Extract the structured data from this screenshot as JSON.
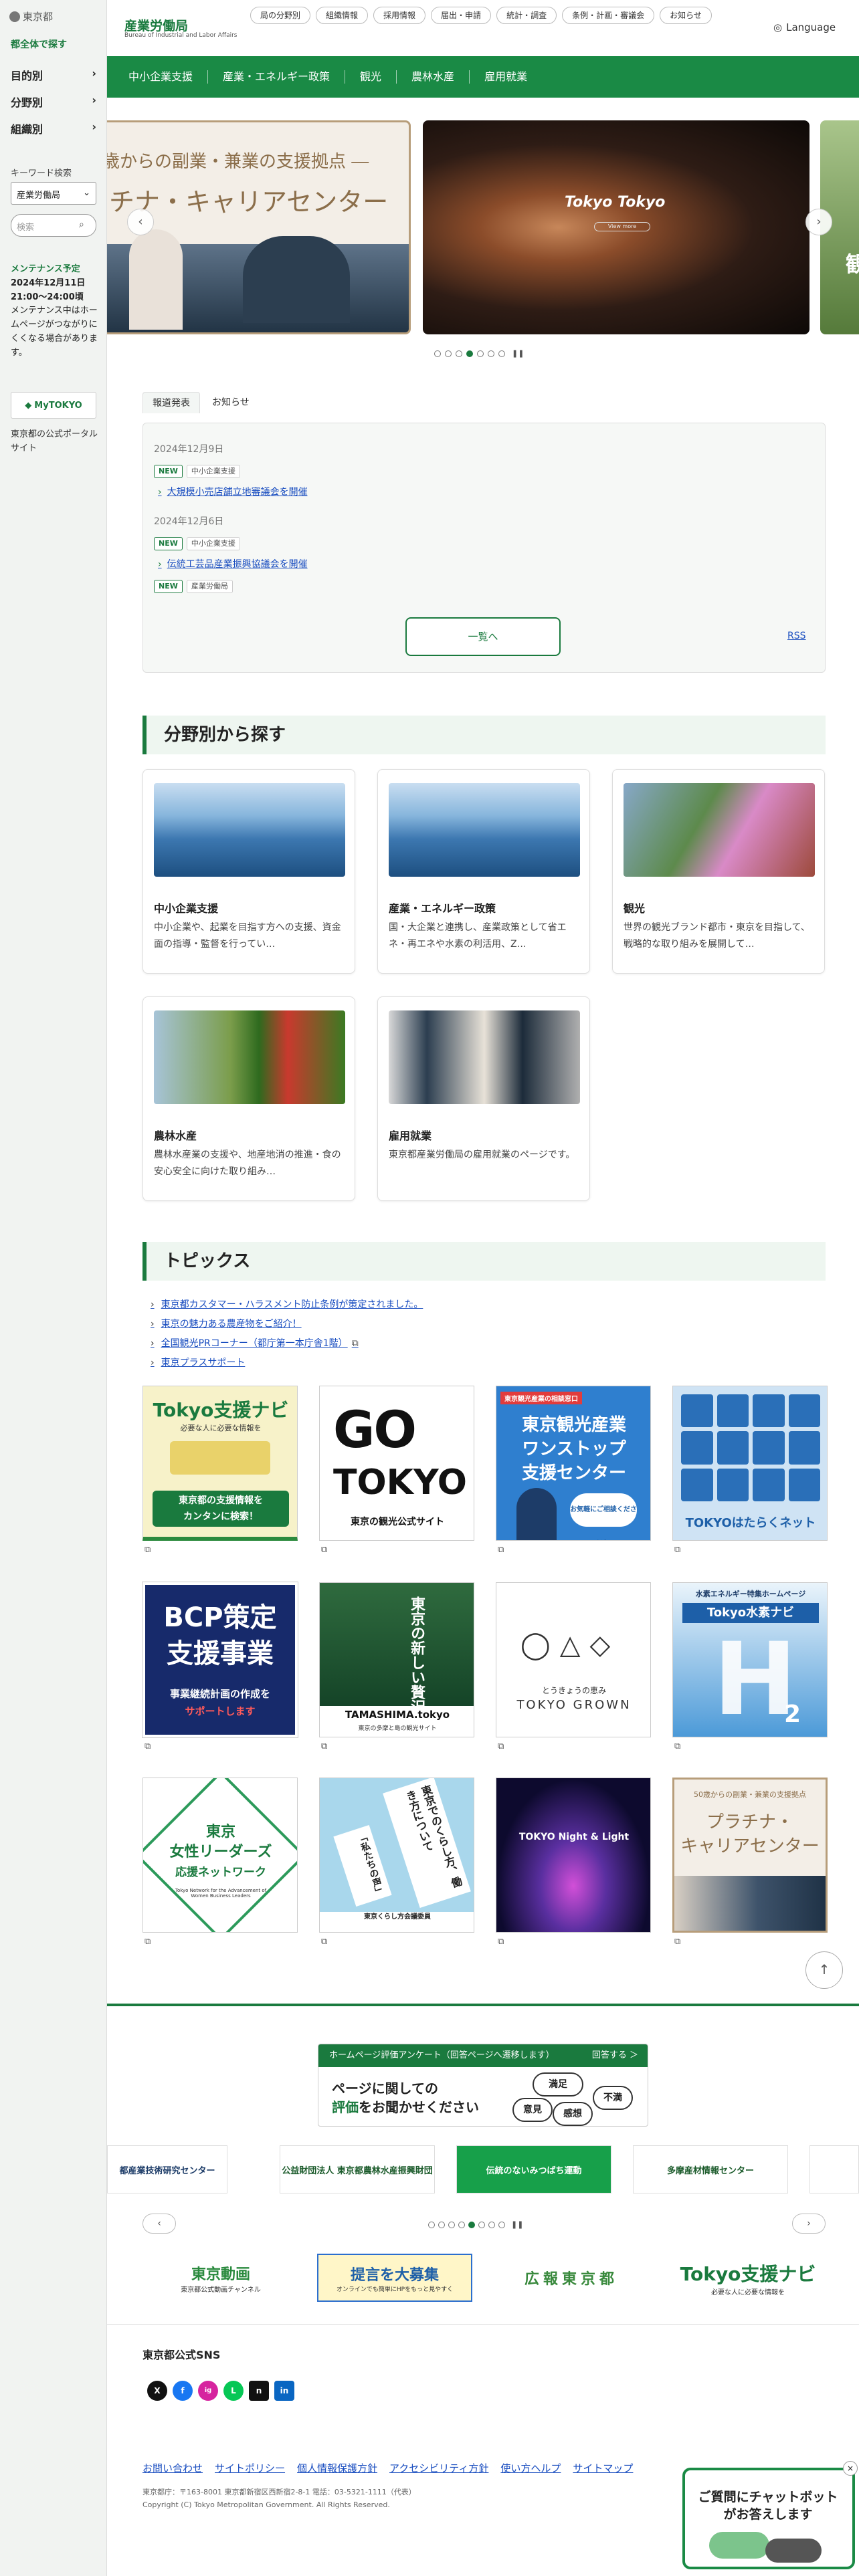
{
  "left": {
    "logo": "東京都",
    "to_all": "都全体で探す",
    "nav": [
      "目的別",
      "分野別",
      "組織別"
    ],
    "kw_label": "キーワード検索",
    "kw_select": "産業労働局",
    "kw_placeholder": "検索",
    "maint_title": "メンテナンス予定",
    "maint_date": "2024年12月11日\n21:00〜24:00頃",
    "maint_desc": "メンテナンス中はホームページがつながりにくくなる場合があります。",
    "mytokyo": "MyTOKYO",
    "mytokyo_desc": "東京都の公式ポータルサイト"
  },
  "header": {
    "title": "産業労働局",
    "subtitle": "Bureau of Industrial and Labor Affairs",
    "links": [
      "局の分野別",
      "組織情報",
      "採用情報",
      "届出・申請",
      "統計・調査",
      "条例・計画・審議会",
      "お知らせ"
    ],
    "lang": "Language"
  },
  "gnav": [
    "中小企業支援",
    "産業・エネルギー政策",
    "観光",
    "農林水産",
    "雇用就業"
  ],
  "carousel": {
    "s1_l1": "歳からの副業・兼業の支援拠点 ―",
    "s1_l2": "チナ・キャリアセンター",
    "s2_title": "Tokyo Tokyo",
    "s2_more": "View more",
    "s3_title": "観"
  },
  "news": {
    "tabs": [
      "報道発表",
      "お知らせ"
    ],
    "items": [
      {
        "date": "2024年12月9日",
        "badge": "NEW",
        "cat": "中小企業支援",
        "title": "大規模小売店舗立地審議会を開催"
      },
      {
        "date": "2024年12月6日",
        "badge": "NEW",
        "cat": "中小企業支援",
        "title": "伝統工芸品産業振興協議会を開催"
      },
      {
        "badge": "NEW",
        "cat": "産業労働局"
      }
    ],
    "more": "一覧へ",
    "rss": "RSS"
  },
  "fields": {
    "heading": "分野別から探す",
    "cards": [
      {
        "title": "中小企業支援",
        "desc": "中小企業や、起業を目指す方への支援、資金面の指導・監督を行ってい…"
      },
      {
        "title": "産業・エネルギー政策",
        "desc": "国・大企業と連携し、産業政策として省エネ・再エネや水素の利活用、Z…"
      },
      {
        "title": "観光",
        "desc": "世界の観光ブランド都市・東京を目指して、戦略的な取り組みを展開して…"
      },
      {
        "title": "農林水産",
        "desc": "農林水産業の支援や、地産地消の推進・食の安心安全に向けた取り組み…"
      },
      {
        "title": "雇用就業",
        "desc": "東京都産業労働局の雇用就業のページです。"
      }
    ]
  },
  "topics": {
    "heading": "トピックス",
    "links": [
      "東京都カスタマー・ハラスメント防止条例が策定されました。",
      "東京の魅力ある農産物をご紹介！",
      "全国観光PRコーナー（都庁第一本庁舎1階）",
      "東京プラスサポート"
    ],
    "banners": {
      "b1": {
        "t1": "Tokyo支援ナビ",
        "t2": "必要な人に必要な情報を",
        "t3": "東京都の支援情報を",
        "t4": "カンタンに検索！"
      },
      "b2": {
        "t1": "GO",
        "t2": "TOKYO",
        "t3": "東京の観光公式サイト"
      },
      "b3": {
        "t0": "東京観光産業の相談窓口",
        "t1": "東京観光産業",
        "t2": "ワンストップ",
        "t3": "支援センター",
        "t4": "お気軽にご相談ください！"
      },
      "b4": {
        "t1": "TOKYOはたらくネット"
      },
      "b5": {
        "t1": "BCP策定",
        "t2": "支援事業",
        "t3": "事業継続計画の作成を",
        "t4": "サポートします"
      },
      "b6": {
        "t1": "東京の",
        "t2": "新しい",
        "t3": "贅沢へ",
        "t4": "TAMASHIMA.tokyo",
        "t5": "東京の多摩と島の観光サイト"
      },
      "b7": {
        "t1": "とうきょうの恵み",
        "t2": "TOKYO GROWN"
      },
      "b8": {
        "t1": "水素エネルギー特集ホームページ",
        "t2": "Tokyo水素ナビ",
        "t3": "H",
        "t4": "2"
      },
      "b9": {
        "t1": "東京",
        "t2": "女性リーダーズ",
        "t3": "応援ネットワーク",
        "t4": "Tokyo Network for the Advancement of Women Business Leaders"
      },
      "b10": {
        "t1": "東京でのくらし方、",
        "t2": "働き方について",
        "t3": "「私たちの声」",
        "t4": "東京くらし方会議委員"
      },
      "b11": {
        "t1": "TOKYO Night & Light"
      },
      "b12": {
        "t1": "50歳からの副業・兼業の支援拠点",
        "t2": "プラチナ・",
        "t3": "キャリアセンター"
      }
    }
  },
  "survey": {
    "bar": "ホームページ評価アンケート（回答ページへ遷移します）",
    "bar_right": "回答する ＞",
    "t1": "ページに関しての",
    "t2a": "評価",
    "t2b": "をお聞かせください",
    "w1": "満足",
    "w2": "意見",
    "w3": "感想",
    "w4": "不満"
  },
  "partners": [
    "都産業技術研究センター",
    "公益財団法人 東京都農林水産振興財団",
    "伝統のないみつばち運動",
    "多摩産材情報センター"
  ],
  "links_banners": [
    "東京動画",
    "提言を大募集",
    "広報東京都",
    "Tokyo支援ナビ"
  ],
  "links_banner_subs": [
    "東京都公式動画チャンネル",
    "オンラインでも簡単にHPをもっと見やすく",
    "",
    "必要な人に必要な情報を"
  ],
  "sns": {
    "title": "東京都公式SNS",
    "icons": [
      "X",
      "f",
      "ig",
      "L",
      "n",
      "in"
    ]
  },
  "footer": {
    "links": [
      "お問い合わせ",
      "サイトポリシー",
      "個人情報保護方針",
      "アクセシビリティ方針",
      "使い方ヘルプ",
      "サイトマップ"
    ],
    "addr": "東京都庁：〒163-8001 東京都新宿区西新宿2-8-1 電話：03-5321-1111（代表）",
    "copy": "Copyright (C) Tokyo Metropolitan Government. All Rights Reserved."
  },
  "chatbot": {
    "text": "ご質問にチャットボットがお答えします",
    "close": "×"
  },
  "colors": {
    "accent": "#1a7a3e",
    "link": "#1a4ec0"
  }
}
